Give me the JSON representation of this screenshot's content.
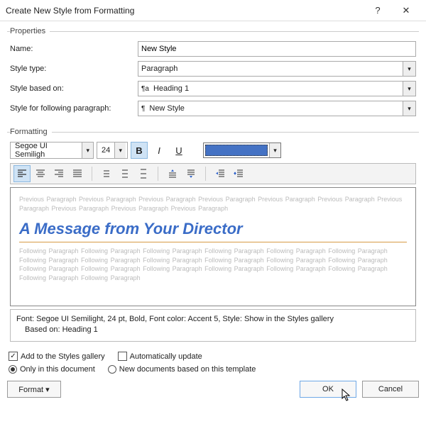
{
  "titlebar": {
    "title": "Create New Style from Formatting"
  },
  "legends": {
    "properties": "Properties",
    "formatting": "Formatting"
  },
  "labels": {
    "name": "Name:",
    "style_type": "Style type:",
    "style_based_on": "Style based on:",
    "style_following": "Style for following paragraph:"
  },
  "fields": {
    "name": "New Style",
    "style_type": "Paragraph",
    "style_based_on": "Heading 1",
    "style_following": "New Style"
  },
  "fmt": {
    "font_name": "Segoe UI Semiligh",
    "font_size": "24"
  },
  "preview": {
    "prev_text": "Previous Paragraph Previous Paragraph Previous Paragraph Previous Paragraph Previous Paragraph Previous Paragraph Previous Paragraph Previous Paragraph Previous Paragraph Previous Paragraph",
    "headline": "A Message from Your Director",
    "follow_text": "Following Paragraph Following Paragraph Following Paragraph Following Paragraph Following Paragraph Following Paragraph Following Paragraph Following Paragraph Following Paragraph Following Paragraph Following Paragraph Following Paragraph Following Paragraph Following Paragraph Following Paragraph Following Paragraph Following Paragraph Following Paragraph Following Paragraph Following Paragraph"
  },
  "description": {
    "line1": "Font: Segoe UI Semilight, 24 pt, Bold, Font color: Accent 5, Style: Show in the Styles gallery",
    "line2": "Based on: Heading 1"
  },
  "options": {
    "add_to_gallery": "Add to the Styles gallery",
    "auto_update": "Automatically update",
    "only_this_doc": "Only in this document",
    "new_docs": "New documents based on this template"
  },
  "buttons": {
    "format": "Format ▾",
    "ok": "OK",
    "cancel": "Cancel"
  }
}
